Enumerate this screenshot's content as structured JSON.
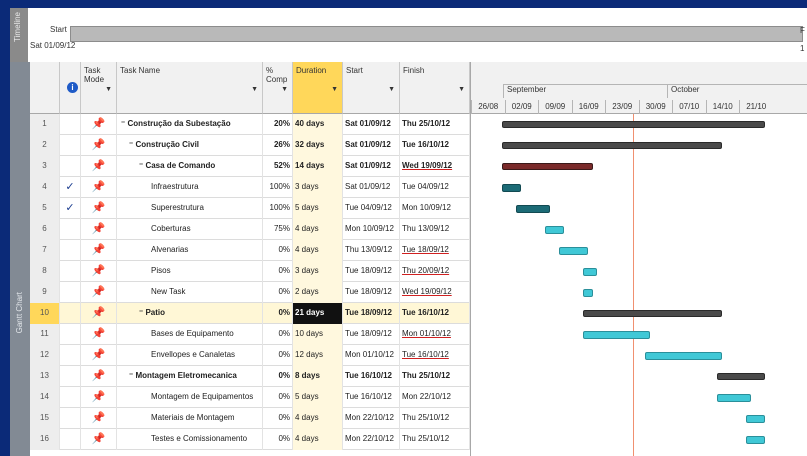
{
  "timeline": {
    "side_label": "Timeline",
    "start_label": "Start",
    "start_date": "Sat 01/09/12",
    "right_label_top": "F",
    "right_label_bottom": "1"
  },
  "side_label": "Gantt Chart",
  "columns": {
    "mode": "Task Mode",
    "name": "Task Name",
    "pct": "% Comp",
    "duration": "Duration",
    "start": "Start",
    "finish": "Finish"
  },
  "gantt": {
    "months": [
      "September",
      "October"
    ],
    "weeks": [
      "26/08",
      "02/09",
      "09/09",
      "16/09",
      "23/09",
      "30/09",
      "07/10",
      "14/10",
      "21/10"
    ]
  },
  "rows": [
    {
      "id": "1",
      "check": "",
      "name": "Construção da Subestação",
      "level": 0,
      "pct": "20%",
      "duration": "40 days",
      "start": "Sat 01/09/12",
      "finish": "Thu 25/10/12"
    },
    {
      "id": "2",
      "check": "",
      "name": "Construção Civil",
      "level": 1,
      "pct": "26%",
      "duration": "32 days",
      "start": "Sat 01/09/12",
      "finish": "Tue 16/10/12"
    },
    {
      "id": "3",
      "check": "",
      "name": "Casa de Comando",
      "level": 2,
      "pct": "52%",
      "duration": "14 days",
      "start": "Sat 01/09/12",
      "finish": "Wed 19/09/12"
    },
    {
      "id": "4",
      "check": "✓",
      "name": "Infraestrutura",
      "level": 3,
      "pct": "100%",
      "duration": "3 days",
      "start": "Sat 01/09/12",
      "finish": "Tue 04/09/12"
    },
    {
      "id": "5",
      "check": "✓",
      "name": "Superestrutura",
      "level": 3,
      "pct": "100%",
      "duration": "5 days",
      "start": "Tue 04/09/12",
      "finish": "Mon 10/09/12"
    },
    {
      "id": "6",
      "check": "",
      "name": "Coberturas",
      "level": 3,
      "pct": "75%",
      "duration": "4 days",
      "start": "Mon 10/09/12",
      "finish": "Thu 13/09/12"
    },
    {
      "id": "7",
      "check": "",
      "name": "Alvenarias",
      "level": 3,
      "pct": "0%",
      "duration": "4 days",
      "start": "Thu 13/09/12",
      "finish": "Tue 18/09/12"
    },
    {
      "id": "8",
      "check": "",
      "name": "Pisos",
      "level": 3,
      "pct": "0%",
      "duration": "3 days",
      "start": "Tue 18/09/12",
      "finish": "Thu 20/09/12"
    },
    {
      "id": "9",
      "check": "",
      "name": "New Task",
      "level": 3,
      "pct": "0%",
      "duration": "2 days",
      "start": "Tue 18/09/12",
      "finish": "Wed 19/09/12"
    },
    {
      "id": "10",
      "check": "",
      "name": "Patio",
      "level": 2,
      "pct": "0%",
      "duration": "21 days",
      "start": "Tue 18/09/12",
      "finish": "Tue 16/10/12"
    },
    {
      "id": "11",
      "check": "",
      "name": "Bases de Equipamento",
      "level": 3,
      "pct": "0%",
      "duration": "10 days",
      "start": "Tue 18/09/12",
      "finish": "Mon 01/10/12"
    },
    {
      "id": "12",
      "check": "",
      "name": "Envellopes e Canaletas",
      "level": 3,
      "pct": "0%",
      "duration": "12 days",
      "start": "Mon 01/10/12",
      "finish": "Tue 16/10/12"
    },
    {
      "id": "13",
      "check": "",
      "name": "Montagem Eletromecanica",
      "level": 1,
      "pct": "0%",
      "duration": "8 days",
      "start": "Tue 16/10/12",
      "finish": "Thu 25/10/12"
    },
    {
      "id": "14",
      "check": "",
      "name": "Montagem de Equipamentos",
      "level": 3,
      "pct": "0%",
      "duration": "5 days",
      "start": "Tue 16/10/12",
      "finish": "Mon 22/10/12"
    },
    {
      "id": "15",
      "check": "",
      "name": "Materiais de Montagem",
      "level": 3,
      "pct": "0%",
      "duration": "4 days",
      "start": "Mon 22/10/12",
      "finish": "Thu 25/10/12"
    },
    {
      "id": "16",
      "check": "",
      "name": "Testes e Comissionamento",
      "level": 3,
      "pct": "0%",
      "duration": "4 days",
      "start": "Mon 22/10/12",
      "finish": "Thu 25/10/12"
    }
  ]
}
